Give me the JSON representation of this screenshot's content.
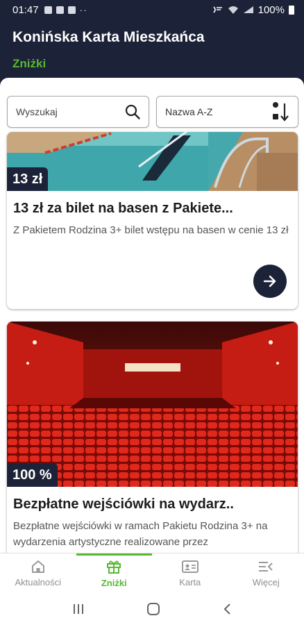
{
  "status": {
    "time": "01:47",
    "battery": "100%"
  },
  "header": {
    "title": "Konińska Karta Mieszkańca",
    "subtitle": "Zniżki"
  },
  "search": {
    "placeholder": "Wyszukaj",
    "sort_label": "Nazwa A-Z"
  },
  "cards": [
    {
      "price": "13 zł",
      "title": "13 zł za bilet na basen z Pakiete...",
      "description": "Z Pakietem Rodzina 3+ bilet wstępu na basen w cenie 13 zł"
    },
    {
      "price": "100 %",
      "title": "Bezpłatne wejściówki na wydarz..",
      "description": "Bezpłatne wejściówki w ramach Pakietu Rodzina 3+ na wydarzenia artystyczne realizowane przez"
    }
  ],
  "bottom_nav": [
    {
      "label": "Aktualności",
      "icon": "home-icon",
      "active": false
    },
    {
      "label": "Zniżki",
      "icon": "gift-icon",
      "active": true
    },
    {
      "label": "Karta",
      "icon": "id-card-icon",
      "active": false
    },
    {
      "label": "Więcej",
      "icon": "more-menu-icon",
      "active": false
    }
  ],
  "colors": {
    "navy": "#1c2237",
    "accent": "#56b92f"
  }
}
